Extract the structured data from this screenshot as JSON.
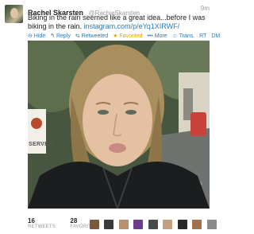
{
  "tweet": {
    "name": "Rachel Skarsten",
    "handle": "@RachieSkarsten",
    "time": "9m",
    "text": "Biking in the rain seemed like a great idea...before I was biking in the rain.",
    "link": "instagram.com/p/eYq1XIRWF/"
  },
  "actions": {
    "hide": "⊖ Hide",
    "reply": "↰ Reply",
    "retweeted": "⇆ Retweeted",
    "favorited": "★ Favorited",
    "more": "••• More",
    "trans": "☺ Trans.",
    "rt": "RT",
    "dm": "DM"
  },
  "photo": {
    "sign_text": "SERVED"
  },
  "stats": {
    "retweets_count": "16",
    "retweets_label": "RETWEETS",
    "favorites_count": "28",
    "favorites_label": "FAVORITES"
  },
  "colors": {
    "link": "#2b7bb9",
    "favorited": "#e0a800",
    "muted": "#999999"
  }
}
